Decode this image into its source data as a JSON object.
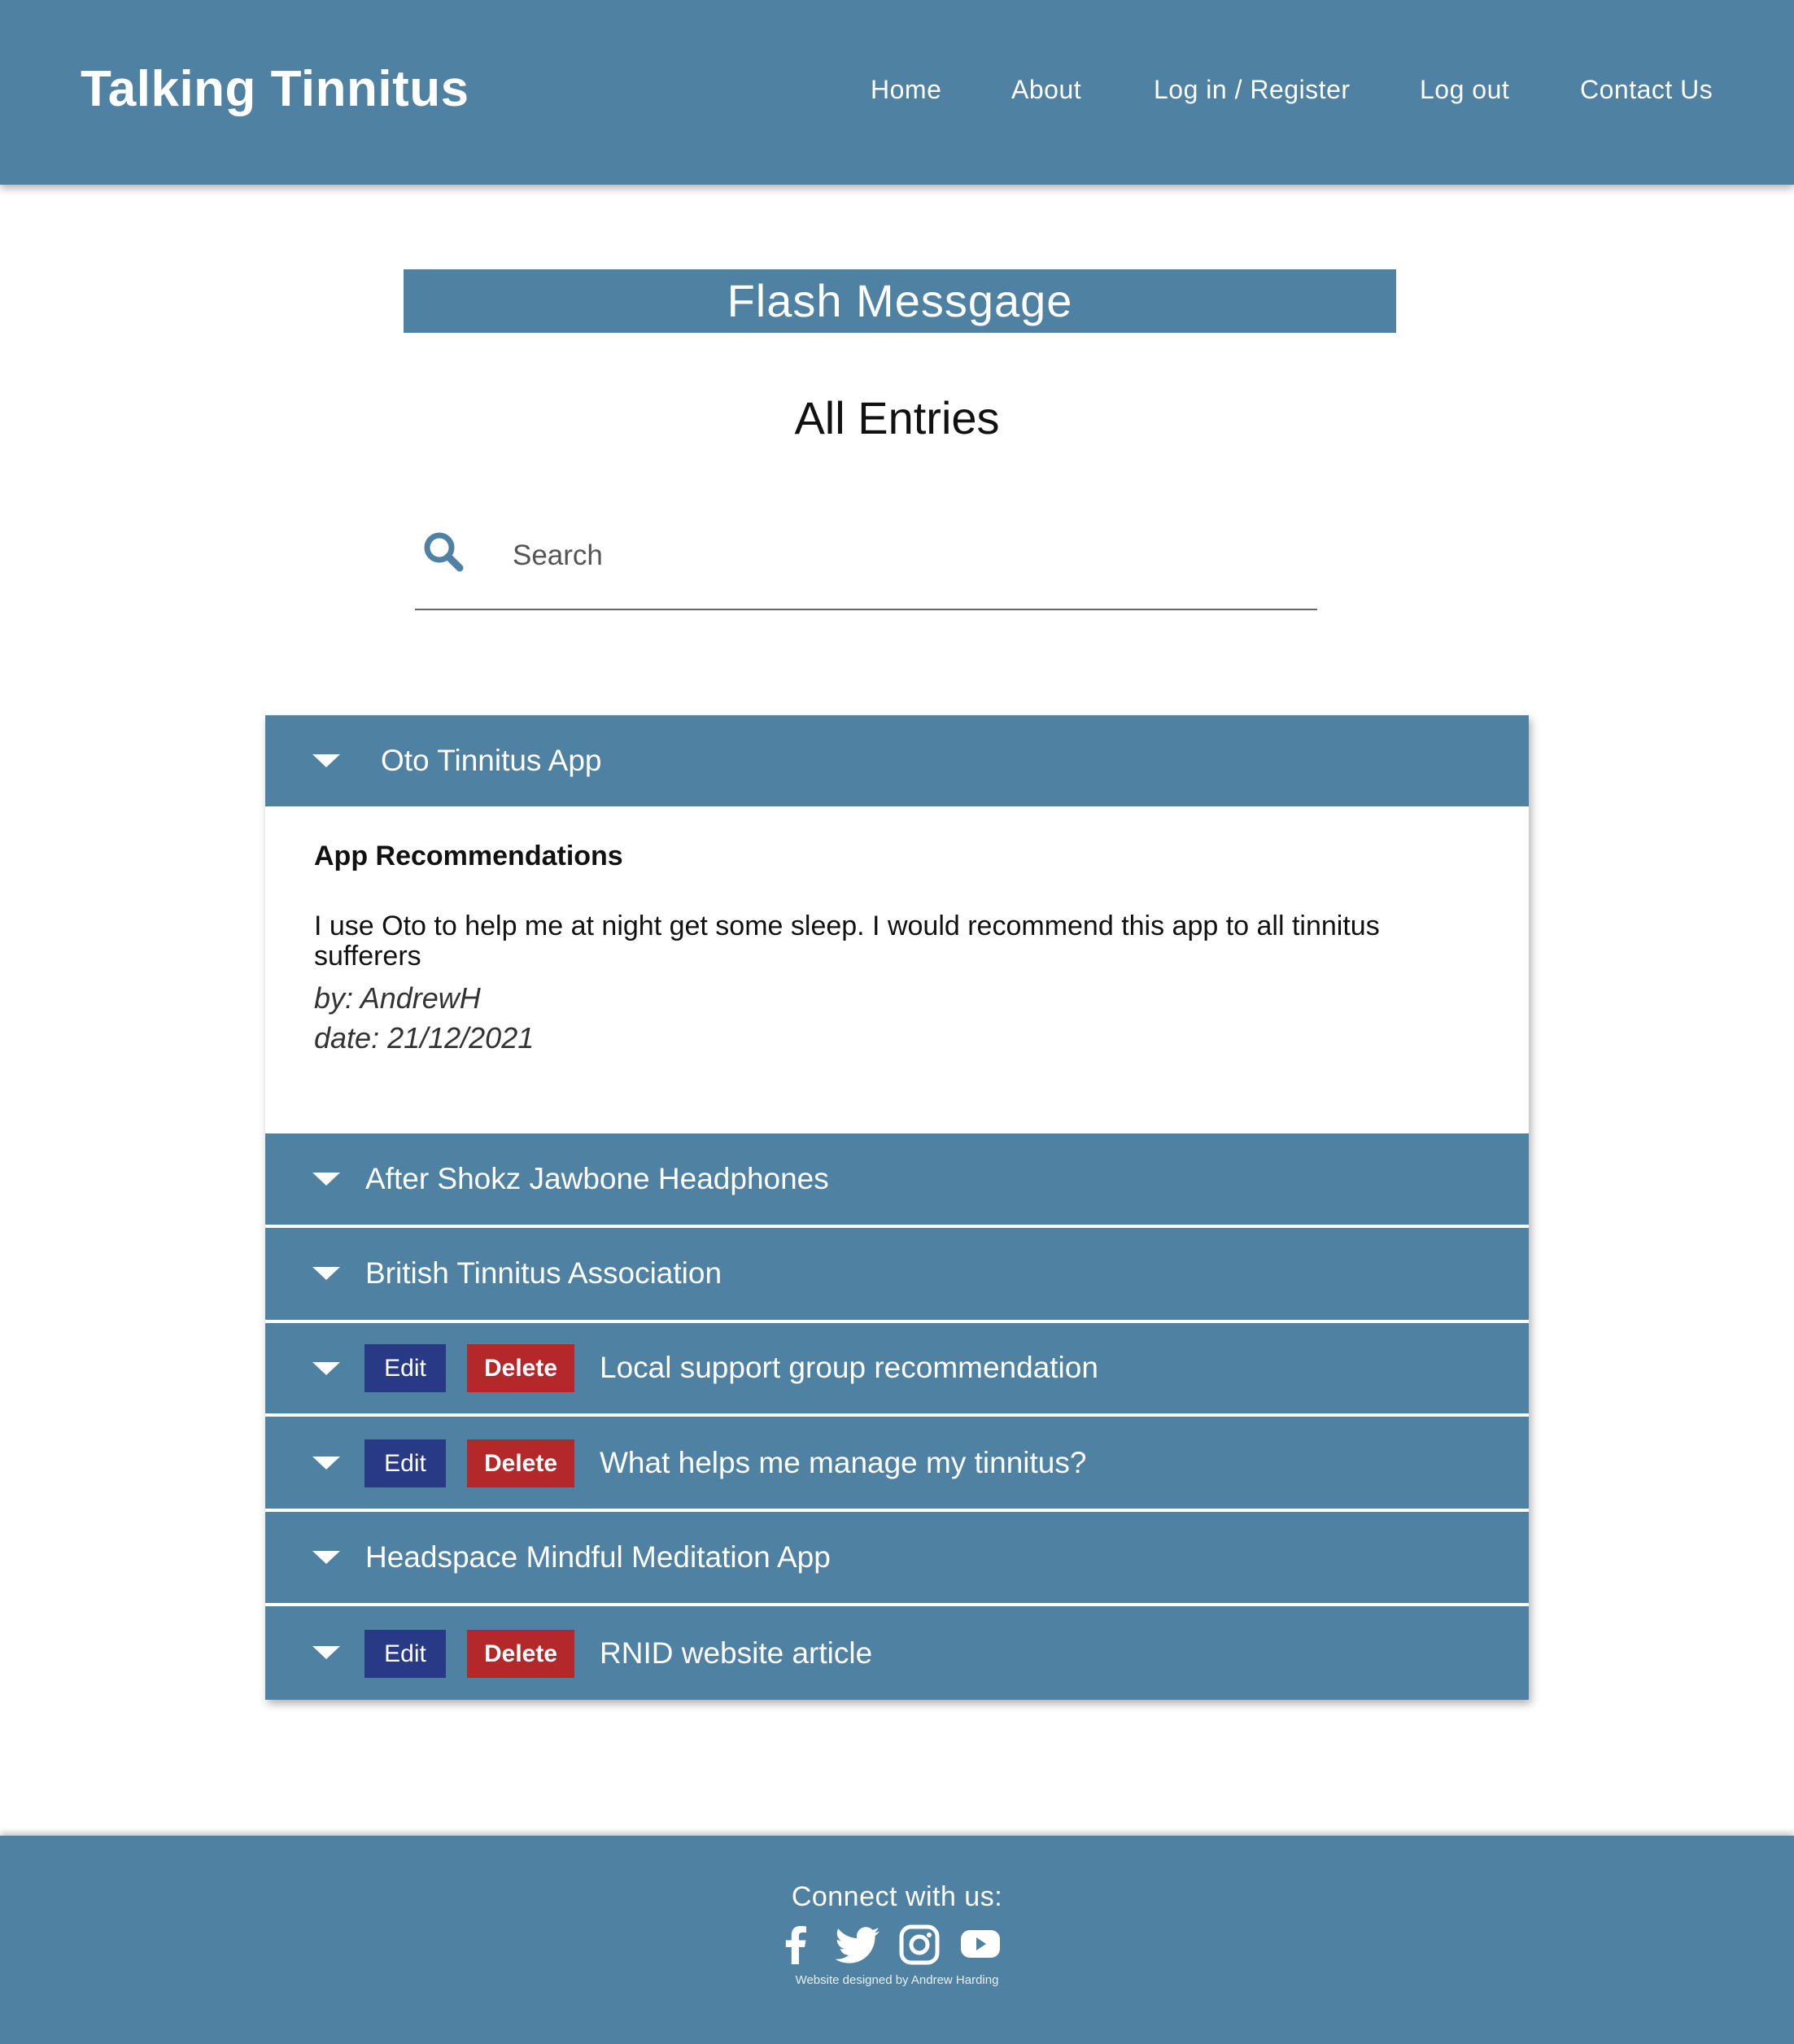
{
  "header": {
    "brand": "Talking Tinnitus",
    "nav": [
      "Home",
      "About",
      "Log in / Register",
      "Log out",
      "Contact Us"
    ]
  },
  "flash_message": "Flash Messgage",
  "page_title": "All Entries",
  "search": {
    "placeholder": "Search",
    "icon": "search-icon"
  },
  "entries": [
    {
      "title": "Oto Tinnitus App",
      "expanded": true,
      "owned": false,
      "heading": "App Recommendations",
      "body": "I use Oto to help me at night get some sleep. I would recommend this app to all tinnitus sufferers",
      "by": "by: AndrewH",
      "date": "date: 21/12/2021"
    },
    {
      "title": "After Shokz Jawbone Headphones",
      "expanded": false,
      "owned": false
    },
    {
      "title": "British Tinnitus Association",
      "expanded": false,
      "owned": false
    },
    {
      "title": "Local support group recommendation",
      "expanded": false,
      "owned": true
    },
    {
      "title": "What helps me manage my tinnitus?",
      "expanded": false,
      "owned": true
    },
    {
      "title": "Headspace Mindful Meditation App",
      "expanded": false,
      "owned": false
    },
    {
      "title": "RNID website article",
      "expanded": false,
      "owned": true
    }
  ],
  "buttons": {
    "edit": "Edit",
    "delete": "Delete"
  },
  "footer": {
    "connect": "Connect with us:",
    "social": [
      "facebook-icon",
      "twitter-icon",
      "instagram-icon",
      "youtube-icon"
    ],
    "credit": "Website designed by Andrew Harding"
  },
  "colors": {
    "primary": "#4f81a2",
    "edit_button": "#283a86",
    "delete_button": "#b5282a",
    "text": "#111111"
  }
}
